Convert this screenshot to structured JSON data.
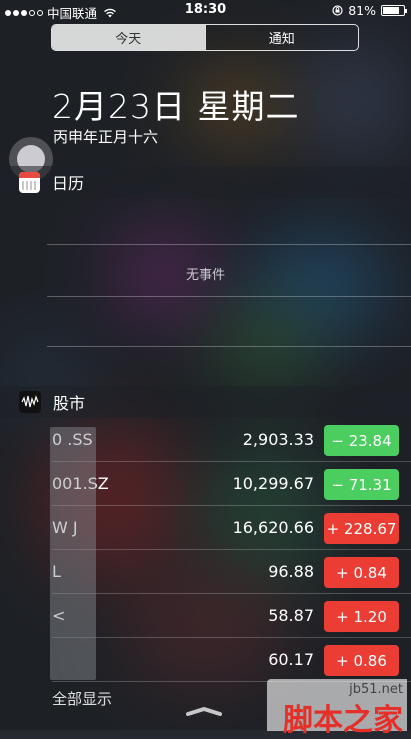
{
  "status_bar": {
    "carrier": "中国联通",
    "time": "18:30",
    "battery_percent": "81%",
    "battery_level": 0.81
  },
  "segments": [
    {
      "label": "今天",
      "active": true
    },
    {
      "label": "通知",
      "active": false
    }
  ],
  "today": {
    "date_title": "2月23日 星期二",
    "lunar_date": "丙申年正月十六"
  },
  "calendar_widget": {
    "title": "日历",
    "empty_text": "无事件"
  },
  "stocks_widget": {
    "title": "股市",
    "rows": [
      {
        "symbol": "0      .SS",
        "price": "2,903.33",
        "change": "− 23.84",
        "direction": "down"
      },
      {
        "symbol": "  001.SZ",
        "price": "10,299.67",
        "change": "− 71.31",
        "direction": "down"
      },
      {
        "symbol": "  W J",
        "price": "16,620.66",
        "change": "+ 228.67",
        "direction": "up"
      },
      {
        "symbol": "  L",
        "price": "96.88",
        "change": "+  0.84",
        "direction": "up"
      },
      {
        "symbol": "  <",
        "price": "58.87",
        "change": "+  1.20",
        "direction": "up"
      },
      {
        "symbol": "",
        "price": "60.17",
        "change": "+  0.86",
        "direction": "up"
      }
    ],
    "show_all_label": "全部显示"
  },
  "watermark": {
    "url": "jb51.net",
    "text": "脚本之家"
  },
  "colors": {
    "up": "#eb3d33",
    "down": "#4bce5f"
  }
}
